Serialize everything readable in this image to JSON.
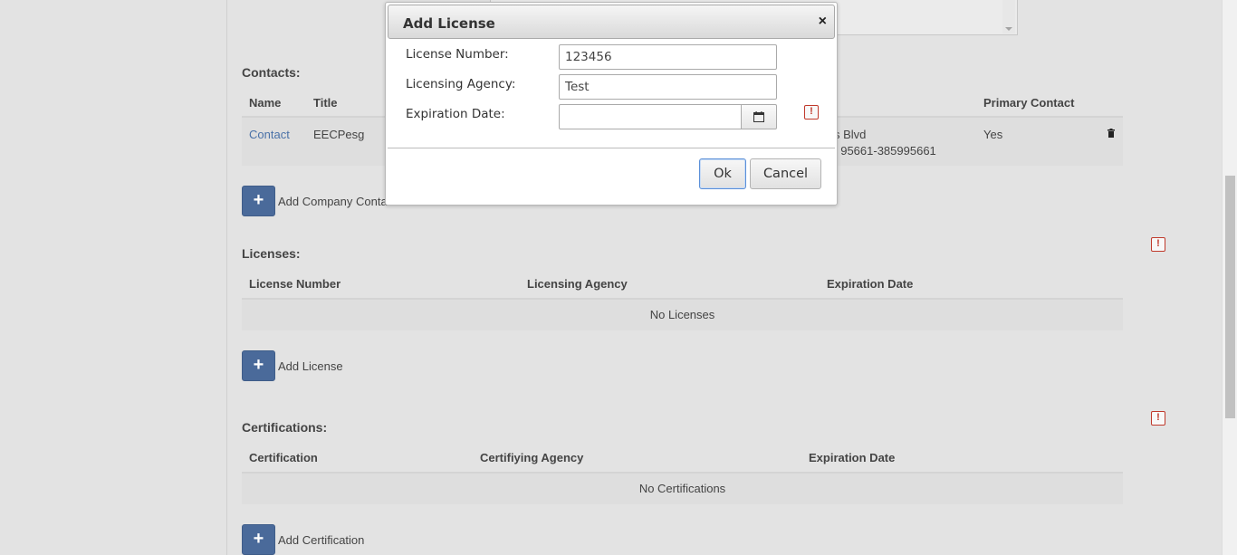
{
  "contacts": {
    "title": "Contacts:",
    "columns": [
      "Name",
      "Title",
      "Primary Contact"
    ],
    "row": {
      "name": "Contact",
      "title": "EECPesg",
      "address_line1": "s Blvd",
      "address_line2": "  95661-385995661",
      "primary": "Yes"
    },
    "add_label": "Add Company Conta"
  },
  "licenses": {
    "title": "Licenses:",
    "columns": [
      "License Number",
      "Licensing Agency",
      "Expiration Date"
    ],
    "empty_text": "No Licenses",
    "add_label": "Add License"
  },
  "certifications": {
    "title": "Certifications:",
    "columns": [
      "Certification",
      "Certifiying Agency",
      "Expiration Date"
    ],
    "empty_text": "No Certifications",
    "add_label": "Add Certification"
  },
  "add_symbol": "+",
  "warning_symbol": "!",
  "modal": {
    "title": "Add License",
    "close_symbol": "×",
    "fields": {
      "license_number_label": "License Number:",
      "license_number_value": "123456",
      "agency_label": "Licensing Agency:",
      "agency_value": "Test",
      "expiration_label": "Expiration Date:",
      "expiration_value": ""
    },
    "ok_label": "Ok",
    "cancel_label": "Cancel"
  },
  "colors": {
    "accent_button": "#4a6a9a",
    "link": "#4a72a8",
    "warning": "#c0392b"
  },
  "icons": [
    "plus-icon",
    "trash-icon",
    "warning-icon",
    "calendar-icon",
    "close-icon"
  ]
}
